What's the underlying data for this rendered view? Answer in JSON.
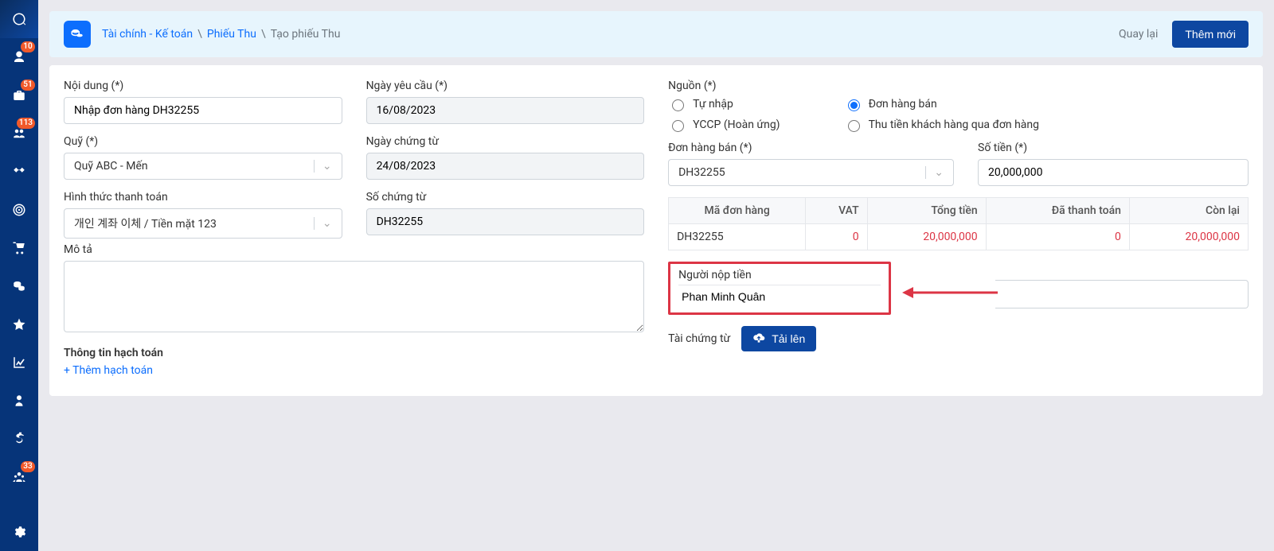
{
  "sidenav": {
    "badges": {
      "users": "10",
      "briefcase": "51",
      "group": "113",
      "team": "33"
    }
  },
  "header": {
    "crumb1": "Tài chính - Kế toán",
    "crumb2": "Phiếu Thu",
    "current": "Tạo phiếu Thu",
    "back": "Quay lại",
    "addNew": "Thêm mới"
  },
  "left": {
    "content_label": "Nội dung (*)",
    "content_value": "Nhập đơn hàng DH32255",
    "fund_label": "Quỹ (*)",
    "fund_value": "Quỹ ABC - Mến",
    "paymethod_label": "Hình thức thanh toán",
    "paymethod_value": "개인 계좌 이체 / Tiền mặt 123",
    "desc_label": "Mô tả",
    "entry_heading": "Thông tin hạch toán",
    "entry_add": "+ Thêm hạch toán"
  },
  "mid": {
    "reqdate_label": "Ngày yêu cầu (*)",
    "reqdate_value": "16/08/2023",
    "docdate_label": "Ngày chứng từ",
    "docdate_value": "24/08/2023",
    "docno_label": "Số chứng từ",
    "docno_value": "DH32255"
  },
  "right": {
    "source_label": "Nguồn (*)",
    "opt_manual": "Tự nhập",
    "opt_yccp": "YCCP (Hoàn ứng)",
    "opt_salesorder": "Đơn hàng bán",
    "opt_collect": "Thu tiền khách hàng qua đơn hàng",
    "order_label": "Đơn hàng bán (*)",
    "order_value": "DH32255",
    "amount_label": "Số tiền (*)",
    "amount_value": "20,000,000",
    "table": {
      "h1": "Mã đơn hàng",
      "h2": "VAT",
      "h3": "Tổng tiền",
      "h4": "Đã thanh toán",
      "h5": "Còn lại",
      "r1": {
        "code": "DH32255",
        "vat": "0",
        "total": "20,000,000",
        "paid": "0",
        "remain": "20,000,000"
      }
    },
    "payer_label": "Người nộp tiền",
    "payer_value": "Phan Minh Quân",
    "doc_label": "Tài chứng từ",
    "upload_btn": "Tải lên"
  }
}
